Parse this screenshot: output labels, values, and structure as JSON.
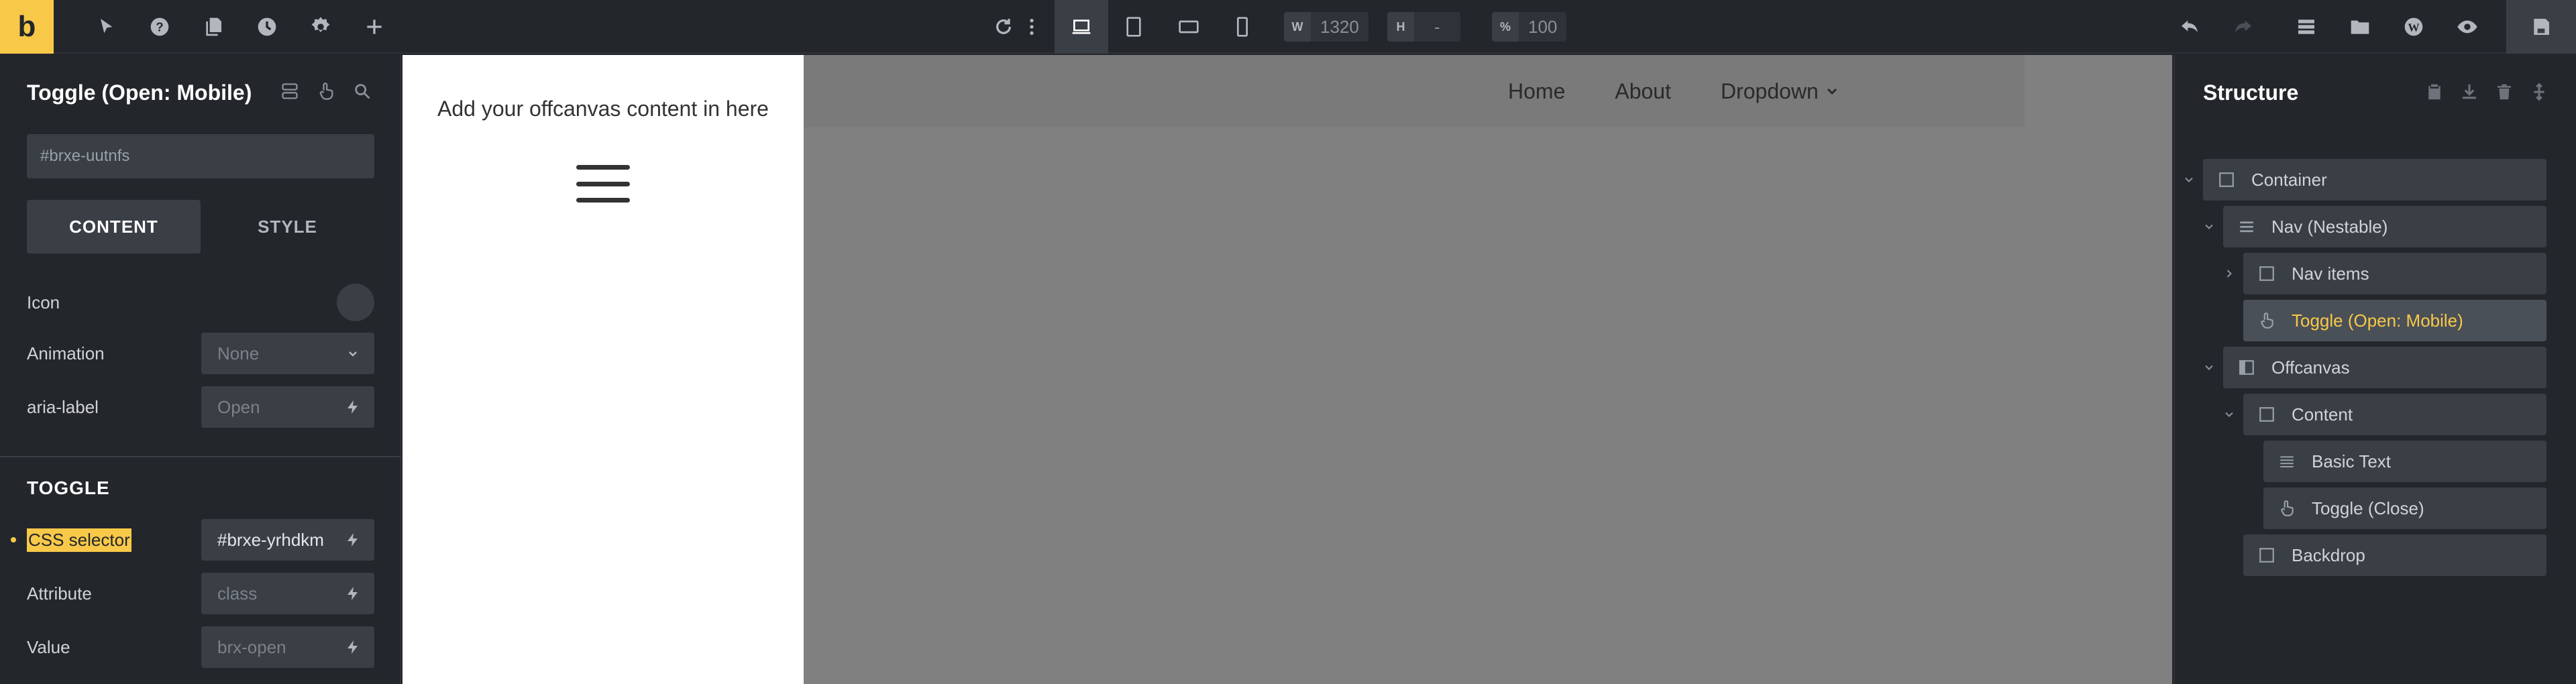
{
  "toolbar": {
    "logo": "b",
    "width_label": "W",
    "width_value": "1320",
    "height_label": "H",
    "height_value": "-",
    "zoom_label": "%",
    "zoom_value": "100"
  },
  "left_panel": {
    "title": "Toggle (Open: Mobile)",
    "element_id": "#brxe-uutnfs",
    "tabs": [
      "CONTENT",
      "STYLE"
    ],
    "controls": {
      "icon_label": "Icon",
      "animation_label": "Animation",
      "animation_value": "None",
      "aria_label": "aria-label",
      "aria_placeholder": "Open"
    },
    "toggle_section": {
      "title": "TOGGLE",
      "css_selector_label": "CSS selector",
      "css_selector_value": "#brxe-yrhdkm",
      "attribute_label": "Attribute",
      "attribute_placeholder": "class",
      "value_label": "Value",
      "value_placeholder": "brx-open"
    }
  },
  "canvas": {
    "offcanvas_text": "Add your offcanvas content in here",
    "nav": [
      "Home",
      "About",
      "Dropdown"
    ]
  },
  "structure": {
    "title": "Structure",
    "items": [
      {
        "label": "Container",
        "icon": "square-icon"
      },
      {
        "label": "Nav (Nestable)",
        "icon": "menu-icon"
      },
      {
        "label": "Nav items",
        "icon": "square-icon"
      },
      {
        "label": "Toggle (Open: Mobile)",
        "icon": "hand-icon"
      },
      {
        "label": "Offcanvas",
        "icon": "sidebar-icon"
      },
      {
        "label": "Content",
        "icon": "square-icon"
      },
      {
        "label": "Basic Text",
        "icon": "text-lines-icon"
      },
      {
        "label": "Toggle (Close)",
        "icon": "hand-icon"
      },
      {
        "label": "Backdrop",
        "icon": "square-icon"
      }
    ]
  },
  "colors": {
    "accent": "#f8c948",
    "panel_bg": "#23262b",
    "input_bg": "#3a3f46",
    "canvas_bg": "#808080"
  }
}
